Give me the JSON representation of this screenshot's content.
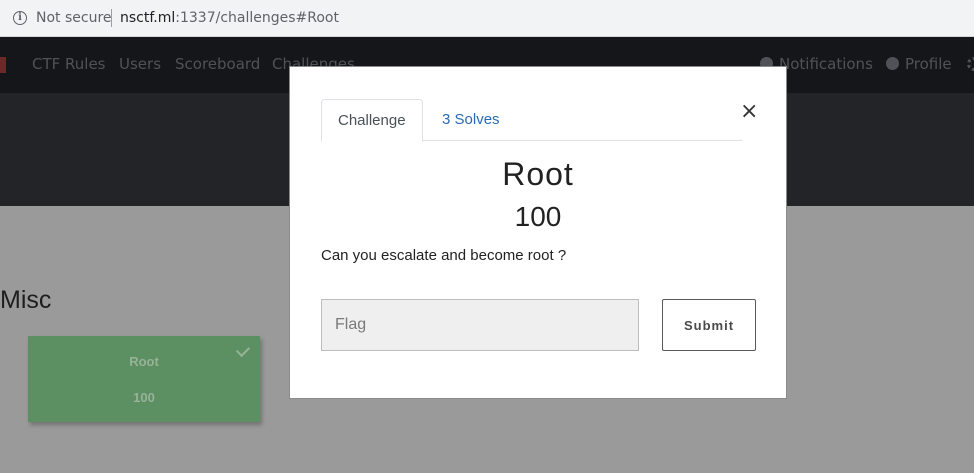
{
  "browser": {
    "security_label": "Not secure",
    "url_host": "nsctf.ml",
    "url_path": ":1337/challenges#Root"
  },
  "navbar": {
    "items": [
      {
        "label": "CTF Rules"
      },
      {
        "label": "Users"
      },
      {
        "label": "Scoreboard"
      },
      {
        "label": "Challenges"
      }
    ],
    "notifications_label": "Notifications",
    "profile_label": "Profile"
  },
  "page": {
    "category": "Misc",
    "challenge_card": {
      "name": "Root",
      "value": "100",
      "solved": true
    }
  },
  "modal": {
    "tabs": [
      {
        "label": "Challenge",
        "active": true
      },
      {
        "label": "3 Solves",
        "active": false
      }
    ],
    "close_label": "×",
    "title": "Root",
    "value": "100",
    "description": "Can you escalate and become root ?",
    "flag_placeholder": "Flag",
    "flag_value": "",
    "submit_label": "Submit"
  },
  "colors": {
    "solved_card": "#5c8f62",
    "link": "#2a6ab3",
    "navbar": "#141619"
  }
}
